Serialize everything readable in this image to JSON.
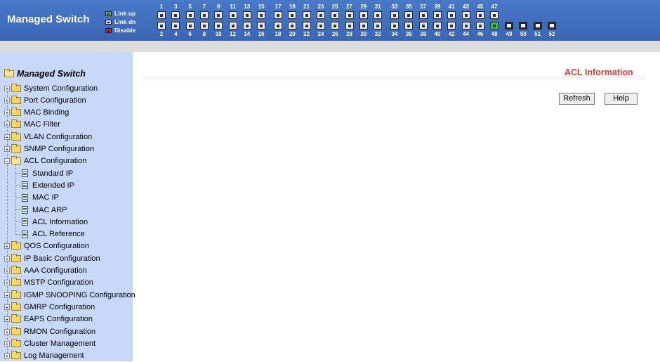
{
  "header": {
    "title": "Managed Switch",
    "legend": [
      {
        "label": "Link up",
        "state": "link-up"
      },
      {
        "label": "Link dn",
        "state": "link-down"
      },
      {
        "label": "Disable",
        "state": "disabled"
      }
    ],
    "colors": {
      "header_bg": "#3a66b4",
      "link_up": "#2ecc40",
      "link_down": "#d8d8d8",
      "disabled": "#e02020"
    },
    "port_groups": [
      {
        "top": [
          "1",
          "3",
          "5",
          "7",
          "9",
          "11",
          "13",
          "15"
        ],
        "bottom": [
          "2",
          "4",
          "6",
          "8",
          "10",
          "12",
          "14",
          "16"
        ]
      },
      {
        "top": [
          "17",
          "19",
          "21",
          "23",
          "25",
          "27",
          "29",
          "31"
        ],
        "bottom": [
          "18",
          "20",
          "22",
          "24",
          "26",
          "28",
          "30",
          "32"
        ]
      },
      {
        "top": [
          "33",
          "35",
          "37",
          "39",
          "41",
          "43",
          "45",
          "47"
        ],
        "bottom": [
          "34",
          "36",
          "38",
          "40",
          "42",
          "44",
          "46",
          "48"
        ]
      }
    ],
    "uplink_ports": [
      "49",
      "50",
      "51",
      "52"
    ],
    "ports_link_up": [
      "48"
    ]
  },
  "sidebar": {
    "root": "Managed Switch",
    "items": [
      {
        "label": "System Configuration",
        "expanded": false
      },
      {
        "label": "Port Configuration",
        "expanded": false
      },
      {
        "label": "MAC Binding",
        "expanded": false
      },
      {
        "label": "MAC Filter",
        "expanded": false
      },
      {
        "label": "VLAN Configuration",
        "expanded": false
      },
      {
        "label": "SNMP Configuration",
        "expanded": false
      },
      {
        "label": "ACL Configuration",
        "expanded": true,
        "children": [
          "Standard IP",
          "Extended IP",
          "MAC IP",
          "MAC ARP",
          "ACL Information",
          "ACL Reference"
        ]
      },
      {
        "label": "QOS Configuration",
        "expanded": false
      },
      {
        "label": "IP Basic Configuration",
        "expanded": false
      },
      {
        "label": "AAA Configuration",
        "expanded": false
      },
      {
        "label": "MSTP Configuration",
        "expanded": false
      },
      {
        "label": "IGMP SNOOPING Configuration",
        "expanded": false
      },
      {
        "label": "GMRP Configuration",
        "expanded": false
      },
      {
        "label": "EAPS Configuration",
        "expanded": false
      },
      {
        "label": "RMON Configuration",
        "expanded": false
      },
      {
        "label": "Cluster Management",
        "expanded": false
      },
      {
        "label": "Log Management",
        "expanded": false
      }
    ]
  },
  "main": {
    "title": "ACL Information",
    "title_color": "#e03838",
    "buttons": {
      "refresh": "Refresh",
      "help": "Help"
    }
  }
}
